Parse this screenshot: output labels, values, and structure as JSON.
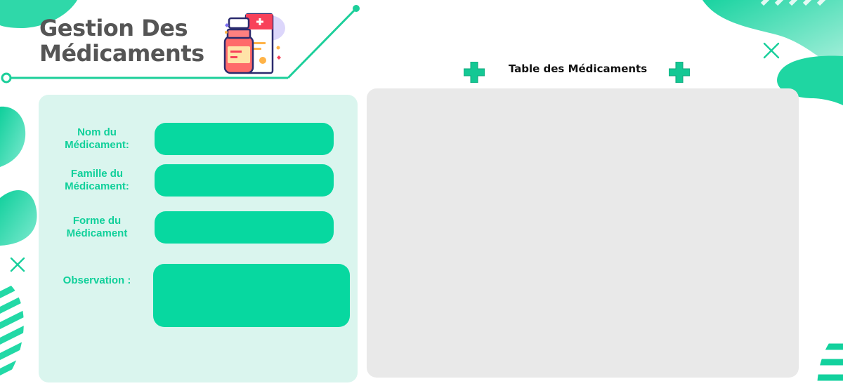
{
  "header": {
    "title_line1": "Gestion Des",
    "title_line2": "Médicaments"
  },
  "form": {
    "nom_label": "Nom du\nMédicament:",
    "famille_label": "Famille  du\nMédicament:",
    "forme_label": "Forme du\nMédicament",
    "observation_label": "Observation :",
    "nom_value": "",
    "famille_value": "",
    "forme_value": "",
    "observation_value": ""
  },
  "table": {
    "title": "Table des Médicaments"
  },
  "colors": {
    "accent": "#07d8a0",
    "panel_bg": "#daf5ee",
    "table_bg": "#e9e9e9",
    "title_text": "#555555"
  },
  "icons": {
    "header_illustration": "medicine-bottle-icon",
    "cross_left": "medical-cross-icon",
    "cross_right": "medical-cross-icon"
  }
}
